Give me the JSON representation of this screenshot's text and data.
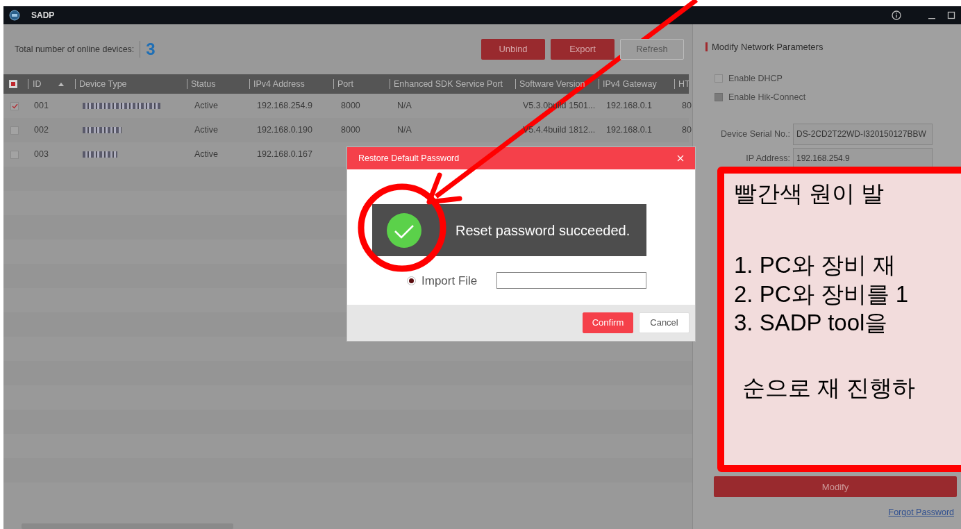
{
  "window": {
    "title": "SADP"
  },
  "summary": {
    "label": "Total number of online devices:",
    "count": "3"
  },
  "toolbar": {
    "buttons": [
      {
        "label": "Unbind",
        "kind": "primary"
      },
      {
        "label": "Export",
        "kind": "primary"
      },
      {
        "label": "Refresh",
        "kind": "outline"
      }
    ]
  },
  "table": {
    "select_all_indeterminate": true,
    "columns": [
      {
        "label": "ID",
        "sorted": true
      },
      {
        "label": "Device Type"
      },
      {
        "label": "Status"
      },
      {
        "label": "IPv4 Address"
      },
      {
        "label": "Port"
      },
      {
        "label": "Enhanced SDK Service Port"
      },
      {
        "label": "Software Version"
      },
      {
        "label": "IPv4 Gateway"
      },
      {
        "label": "HT"
      }
    ],
    "rows": [
      {
        "checked": true,
        "cells": [
          "001",
          null,
          "Active",
          "192.168.254.9",
          "8000",
          "N/A",
          "V5.3.0build 1501...",
          "192.168.0.1",
          "80"
        ]
      },
      {
        "checked": false,
        "cells": [
          "002",
          null,
          "Active",
          "192.168.0.190",
          "8000",
          "N/A",
          "V5.4.4build 1812...",
          "192.168.0.1",
          "80"
        ]
      },
      {
        "checked": false,
        "cells": [
          "003",
          null,
          "Active",
          "192.168.0.167"
        ]
      }
    ]
  },
  "panel": {
    "title": "Modify Network Parameters",
    "checkboxes": [
      {
        "label": "Enable DHCP",
        "checked": false,
        "disabled": false
      },
      {
        "label": "Enable Hik-Connect",
        "checked": false,
        "disabled": true
      }
    ],
    "fields": [
      {
        "label": "Device Serial No.:",
        "value": "DS-2CD2T22WD-I320150127BBW"
      },
      {
        "label": "IP Address:",
        "value": "192.168.254.9"
      }
    ],
    "modify_button": "Modify",
    "forgot_link": "Forgot Password"
  },
  "dialog": {
    "title": "Restore Default Password",
    "option": {
      "label": "Import File",
      "selected": true
    },
    "toast": "Reset password succeeded.",
    "buttons": [
      {
        "label": "Confirm",
        "kind": "primary"
      },
      {
        "label": "Cancel",
        "kind": "secondary"
      }
    ]
  },
  "callout": {
    "title": "빨간색 원이 발",
    "steps": [
      "1. PC와 장비 재",
      "2. PC와 장비를 1",
      "3. SADP tool을"
    ],
    "footer": "순으로 재 진행하"
  }
}
